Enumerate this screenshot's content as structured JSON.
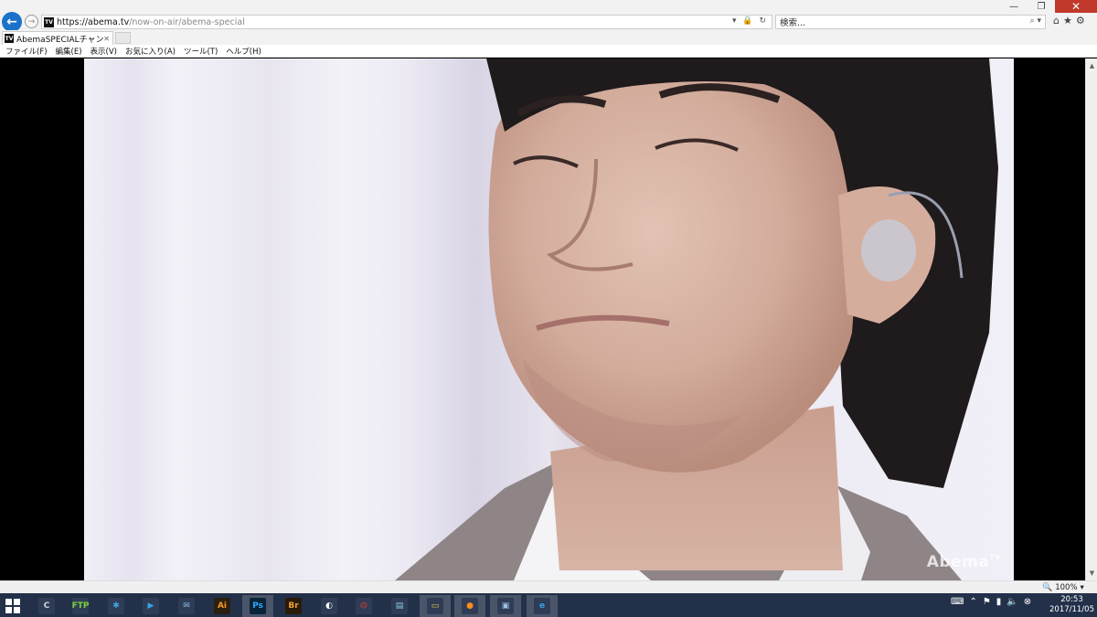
{
  "window": {
    "minimize": "—",
    "restore": "❐",
    "close": "✕"
  },
  "address": {
    "url_host": "https://abema.tv",
    "url_path": "/now-on-air/abema-special",
    "favicon_text": "TV",
    "search_placeholder": "検索..."
  },
  "tab": {
    "title": "AbemaSPECIALチャンネル ...",
    "favicon_text": "TV"
  },
  "menu": [
    "ファイル(F)",
    "編集(E)",
    "表示(V)",
    "お気に入り(A)",
    "ツール(T)",
    "ヘルプ(H)"
  ],
  "video": {
    "watermark": "Abema",
    "watermark_sup": "TV"
  },
  "status": {
    "zoom": "100%"
  },
  "taskbar": {
    "apps": [
      {
        "name": "ccleaner-icon",
        "glyph": "C",
        "bg": "#2e3d55",
        "fg": "#cfd8e3"
      },
      {
        "name": "ftp-icon",
        "glyph": "FTP",
        "bg": "#2e3d55",
        "fg": "#7ad23a"
      },
      {
        "name": "network-icon",
        "glyph": "✱",
        "bg": "#2e3d55",
        "fg": "#3fa3e6"
      },
      {
        "name": "media-player-icon",
        "glyph": "▶",
        "bg": "#2e3d55",
        "fg": "#39a1e8"
      },
      {
        "name": "thunderbird-icon",
        "glyph": "✉",
        "bg": "#2e3d55",
        "fg": "#8bb8e8"
      },
      {
        "name": "illustrator-icon",
        "glyph": "Ai",
        "bg": "#2b1f10",
        "fg": "#f79a1f"
      },
      {
        "name": "photoshop-icon",
        "glyph": "Ps",
        "bg": "#0a2338",
        "fg": "#31a8ff"
      },
      {
        "name": "bridge-icon",
        "glyph": "Br",
        "bg": "#2a1a08",
        "fg": "#e8a13c"
      },
      {
        "name": "clip-studio-icon",
        "glyph": "◐",
        "bg": "#2e3d55",
        "fg": "#ffffff"
      },
      {
        "name": "acrobat-icon",
        "glyph": "⏣",
        "bg": "#2e3d55",
        "fg": "#e23b2e"
      },
      {
        "name": "notepad-icon",
        "glyph": "▤",
        "bg": "#2e3d55",
        "fg": "#8fc6e8"
      },
      {
        "name": "explorer-icon",
        "glyph": "▭",
        "bg": "#2e3d55",
        "fg": "#f3c84b"
      },
      {
        "name": "firefox-icon",
        "glyph": "●",
        "bg": "#2e3d55",
        "fg": "#ff8a1e"
      },
      {
        "name": "image-viewer-icon",
        "glyph": "▣",
        "bg": "#2e3d55",
        "fg": "#9ec3e6"
      },
      {
        "name": "internet-explorer-icon",
        "glyph": "e",
        "bg": "#2e3d55",
        "fg": "#3aa0e6"
      }
    ],
    "time": "20:53",
    "date": "2017/11/05"
  }
}
